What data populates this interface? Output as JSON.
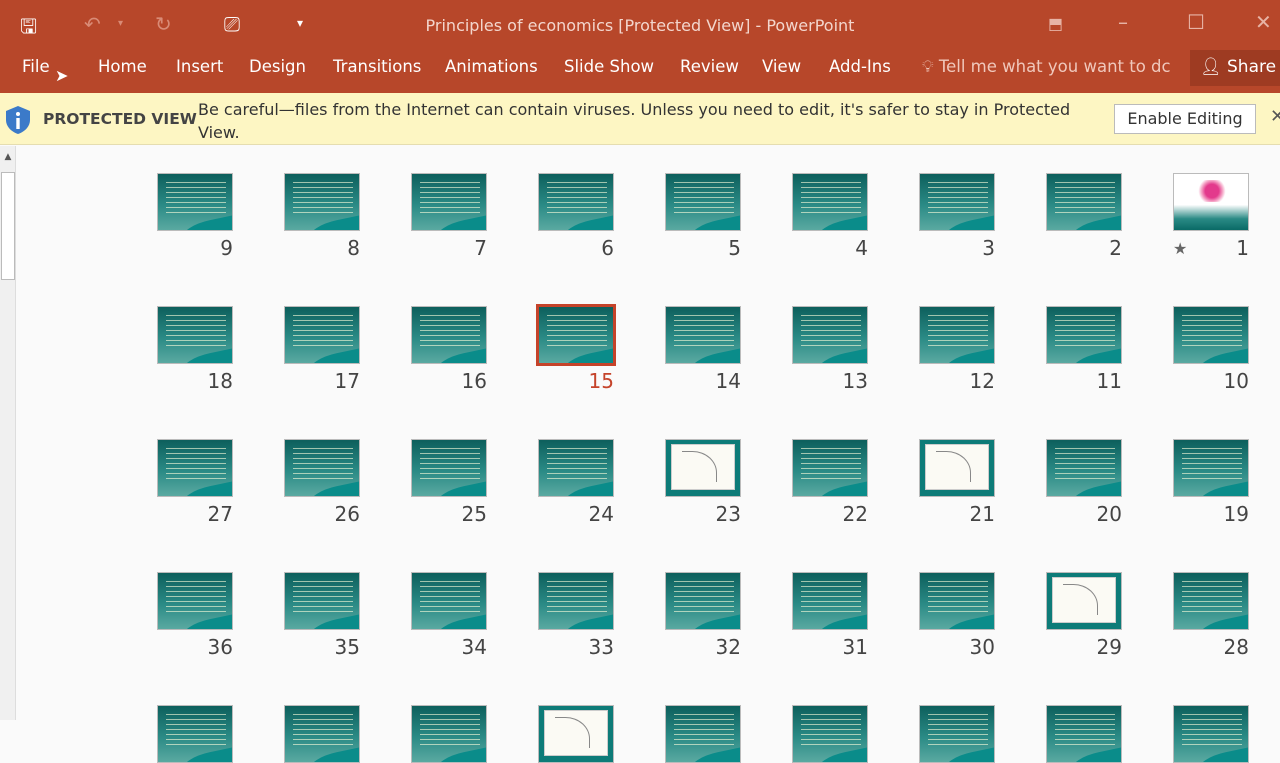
{
  "window": {
    "title": "Principles of economics [Protected View] - PowerPoint"
  },
  "quick_access": [
    {
      "icon": "save-icon",
      "glyph": "🖫"
    },
    {
      "icon": "undo-icon",
      "glyph": "↶"
    },
    {
      "icon": "redo-icon",
      "glyph": "↻"
    },
    {
      "icon": "present-icon",
      "glyph": "⎚"
    },
    {
      "icon": "customize-icon",
      "glyph": "▾"
    }
  ],
  "ribbon": {
    "tabs": [
      "File",
      "Home",
      "Insert",
      "Design",
      "Transitions",
      "Animations",
      "Slide Show",
      "Review",
      "View",
      "Add-Ins"
    ],
    "tell_me": "Tell me what you want to dc",
    "share": "Share"
  },
  "protected_view": {
    "label": "PROTECTED VIEW",
    "message": "Be careful—files from the Internet can contain viruses. Unless you need to edit, it's safer to stay in Protected View.",
    "button": "Enable Editing",
    "close": "✕"
  },
  "selected_slide": 15,
  "colors": {
    "accent": "#b7472a",
    "selection": "#c5432a",
    "banner": "#fdf6c3"
  },
  "slides": [
    {
      "number": "1",
      "kind": "flower",
      "star": "★"
    },
    {
      "number": "2",
      "kind": "text"
    },
    {
      "number": "3",
      "kind": "text"
    },
    {
      "number": "4",
      "kind": "text"
    },
    {
      "number": "5",
      "kind": "text"
    },
    {
      "number": "6",
      "kind": "text"
    },
    {
      "number": "7",
      "kind": "text"
    },
    {
      "number": "8",
      "kind": "text"
    },
    {
      "number": "9",
      "kind": "text"
    },
    {
      "number": "10",
      "kind": "text"
    },
    {
      "number": "11",
      "kind": "text"
    },
    {
      "number": "12",
      "kind": "text"
    },
    {
      "number": "13",
      "kind": "text"
    },
    {
      "number": "14",
      "kind": "text"
    },
    {
      "number": "15",
      "kind": "text"
    },
    {
      "number": "16",
      "kind": "text"
    },
    {
      "number": "17",
      "kind": "text"
    },
    {
      "number": "18",
      "kind": "text"
    },
    {
      "number": "19",
      "kind": "text"
    },
    {
      "number": "20",
      "kind": "text"
    },
    {
      "number": "21",
      "kind": "chart"
    },
    {
      "number": "22",
      "kind": "text"
    },
    {
      "number": "23",
      "kind": "chart"
    },
    {
      "number": "24",
      "kind": "text"
    },
    {
      "number": "25",
      "kind": "text"
    },
    {
      "number": "26",
      "kind": "text"
    },
    {
      "number": "27",
      "kind": "text"
    },
    {
      "number": "28",
      "kind": "text"
    },
    {
      "number": "29",
      "kind": "chart"
    },
    {
      "number": "30",
      "kind": "text"
    },
    {
      "number": "31",
      "kind": "text"
    },
    {
      "number": "32",
      "kind": "text"
    },
    {
      "number": "33",
      "kind": "text"
    },
    {
      "number": "34",
      "kind": "text"
    },
    {
      "number": "35",
      "kind": "text"
    },
    {
      "number": "36",
      "kind": "text"
    },
    {
      "number": "",
      "kind": "text"
    },
    {
      "number": "",
      "kind": "text"
    },
    {
      "number": "",
      "kind": "text"
    },
    {
      "number": "",
      "kind": "text"
    },
    {
      "number": "",
      "kind": "text"
    },
    {
      "number": "",
      "kind": "chart"
    },
    {
      "number": "",
      "kind": "text"
    },
    {
      "number": "",
      "kind": "text"
    },
    {
      "number": "",
      "kind": "text"
    }
  ]
}
